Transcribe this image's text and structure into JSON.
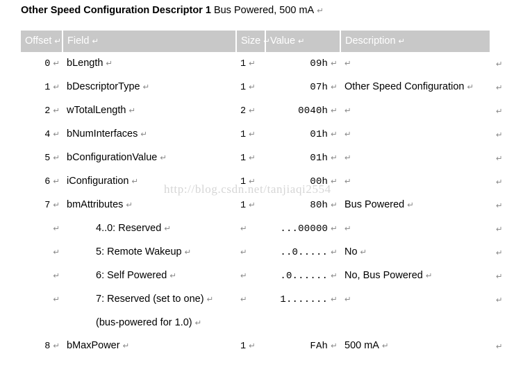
{
  "title": {
    "bold": "Other Speed Configuration Descriptor 1",
    "rest": " Bus Powered, 500 mA",
    "mark": "↵"
  },
  "marks": {
    "pilcrow": "↵",
    "return": "↵"
  },
  "watermark": "http://blog.csdn.net/tanjiaqi2554",
  "colors": {
    "header_background": "#c8c8c8",
    "header_text": "#ffffff",
    "body_text": "#000000",
    "mark_gray": "#8a8a8a",
    "watermark": "#d6d6d6",
    "page_background": "#ffffff"
  },
  "table": {
    "columns": [
      {
        "key": "offset",
        "label": "Offset"
      },
      {
        "key": "field",
        "label": "Field"
      },
      {
        "key": "size",
        "label": "Size"
      },
      {
        "key": "value",
        "label": "Value"
      },
      {
        "key": "description",
        "label": "Description"
      },
      {
        "key": "endmark",
        "label": ""
      }
    ],
    "rows": [
      {
        "offset": "0",
        "field": "bLength",
        "size": "1",
        "value": "09h",
        "description": "",
        "indented": false
      },
      {
        "offset": "1",
        "field": "bDescriptorType",
        "size": "1",
        "value": "07h",
        "description": "Other Speed Configuration",
        "indented": false
      },
      {
        "offset": "2",
        "field": "wTotalLength",
        "size": "2",
        "value": "0040h",
        "description": "",
        "indented": false
      },
      {
        "offset": "4",
        "field": "bNumInterfaces",
        "size": "1",
        "value": "01h",
        "description": "",
        "indented": false
      },
      {
        "offset": "5",
        "field": "bConfigurationValue",
        "size": "1",
        "value": "01h",
        "description": "",
        "indented": false
      },
      {
        "offset": "6",
        "field": "iConfiguration",
        "size": "1",
        "value": "00h",
        "description": "",
        "indented": false
      },
      {
        "offset": "7",
        "field": "bmAttributes",
        "size": "1",
        "value": "80h",
        "description": "Bus Powered",
        "indented": false
      },
      {
        "offset": "",
        "field": "4..0: Reserved",
        "size": "",
        "value": "...00000",
        "description": "",
        "indented": true
      },
      {
        "offset": "",
        "field": "5: Remote Wakeup",
        "size": "",
        "value": "..0.....",
        "description": "No",
        "indented": true
      },
      {
        "offset": "",
        "field": "6: Self Powered",
        "size": "",
        "value": ".0......",
        "description": "No, Bus Powered",
        "indented": true
      },
      {
        "offset": "",
        "field": "7: Reserved (set to one)",
        "size": "",
        "value": "1.......",
        "description": "",
        "indented": true
      },
      {
        "offset": "",
        "field": "(bus-powered for 1.0)",
        "size": "",
        "value": "",
        "description": "",
        "indented": true,
        "continuation": true
      },
      {
        "offset": "8",
        "field": "bMaxPower",
        "size": "1",
        "value": "FAh",
        "description": "500 mA",
        "indented": false
      }
    ]
  }
}
